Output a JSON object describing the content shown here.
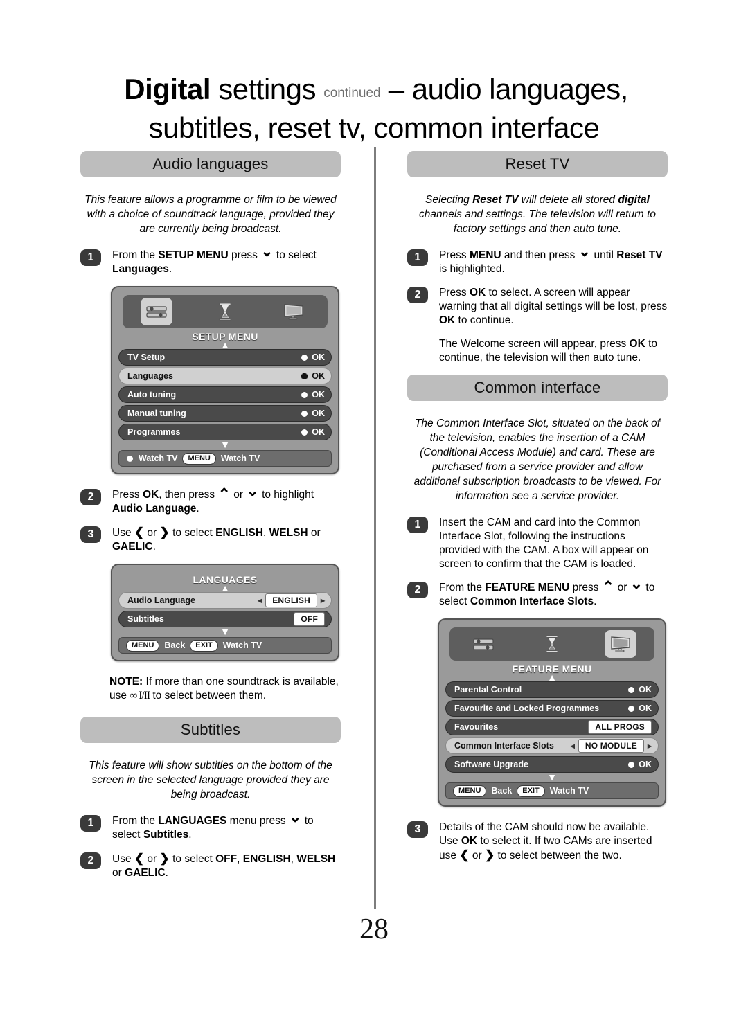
{
  "title": {
    "bold": "Digital",
    "regular": " settings ",
    "continued": "continued",
    "rest": " – audio languages,",
    "line2": "subtitles, reset tv, common interface"
  },
  "page_number": "28",
  "left_column": {
    "audio_languages": {
      "heading": "Audio languages",
      "intro": "This feature allows a programme or film to be viewed with a choice of soundtrack language, provided they are currently being broadcast.",
      "steps": [
        {
          "num": "1",
          "text_html": "From the <b>SETUP MENU</b> press <span class=\"ar ar-dn\"></span> to select <b>Languages</b>."
        },
        {
          "num": "2",
          "text_html": "Press <b>OK</b>, then press <span class=\"ar ar-up\"></span> or <span class=\"ar ar-dn\"></span> to highlight <b>Audio Language</b>."
        },
        {
          "num": "3",
          "text_html": "Use <span class=\"ar ar-lt\"></span> or <span class=\"ar ar-rt\"></span> to select <b>ENGLISH</b>, <b>WELSH</b> or <b>GAELIC</b>."
        }
      ],
      "note_html": "<b>NOTE:</b> If more than one soundtrack is available, use <span class=\"ii-glyph\">∞ I/II</span> to select between them."
    },
    "setup_menu_screen": {
      "title": "SETUP MENU",
      "icons": [
        "setup-sliders-icon",
        "hourglass-icon",
        "tv-screen-icon"
      ],
      "selected_icon_index": 0,
      "rows": [
        {
          "label": "TV Setup",
          "value": "OK",
          "highlighted": false,
          "control": "ok"
        },
        {
          "label": "Languages",
          "value": "OK",
          "highlighted": true,
          "control": "ok4"
        },
        {
          "label": "Auto tuning",
          "value": "OK",
          "highlighted": false,
          "control": "ok"
        },
        {
          "label": "Manual tuning",
          "value": "OK",
          "highlighted": false,
          "control": "ok"
        },
        {
          "label": "Programmes",
          "value": "OK",
          "highlighted": false,
          "control": "ok"
        }
      ],
      "footer": {
        "left_label": "Watch TV",
        "pill": "MENU",
        "right_label": "Watch TV"
      }
    },
    "languages_screen": {
      "title": "LANGUAGES",
      "rows": [
        {
          "label": "Audio Language",
          "value": "ENGLISH",
          "highlighted": true,
          "control": "lr"
        },
        {
          "label": "Subtitles",
          "value": "OFF",
          "highlighted": false,
          "control": "val"
        }
      ],
      "footer": {
        "pill1": "MENU",
        "label1": "Back",
        "pill2": "EXIT",
        "label2": "Watch TV"
      }
    },
    "subtitles": {
      "heading": "Subtitles",
      "intro": "This feature will show subtitles on the bottom of the screen in the selected language provided they are being broadcast.",
      "steps": [
        {
          "num": "1",
          "text_html": "From the <b>LANGUAGES</b> menu press <span class=\"ar ar-dn\"></span> to select <b>Subtitles</b>."
        },
        {
          "num": "2",
          "text_html": "Use <span class=\"ar ar-lt\"></span> or <span class=\"ar ar-rt\"></span> to select <b>OFF</b>, <b>ENGLISH</b>, <b>WELSH</b> or <b>GAELIC</b>."
        }
      ]
    }
  },
  "right_column": {
    "reset_tv": {
      "heading": "Reset TV",
      "intro_html": "Selecting <b>Reset TV</b> will delete all stored <b>digital</b> channels and settings. The television will return to factory settings and then auto tune.",
      "steps": [
        {
          "num": "1",
          "text_html": "Press <b>MENU</b> and then press <span class=\"ar ar-dn\"></span> until <b>Reset TV</b> is highlighted."
        },
        {
          "num": "2",
          "text_html": "Press <b>OK</b> to select. A screen will appear warning that all digital settings will be lost, press <b>OK</b> to continue."
        }
      ],
      "extra_para_html": "The Welcome screen will appear, press <b>OK</b> to continue, the television will then auto tune."
    },
    "common_interface": {
      "heading": "Common interface",
      "intro": "The Common Interface Slot, situated on the back of the television, enables the insertion of a CAM (Conditional Access Module) and card. These are purchased from a service provider and allow additional subscription broadcasts to be viewed. For information see a service provider.",
      "steps": [
        {
          "num": "1",
          "text_html": "Insert the CAM and card into the Common Interface Slot, following the instructions provided with the CAM. A box will appear on screen to confirm that the CAM is loaded."
        },
        {
          "num": "2",
          "text_html": "From the <b>FEATURE MENU</b> press <span class=\"ar ar-up\"></span> or <span class=\"ar ar-dn\"></span> to select <b>Common Interface Slots</b>."
        }
      ],
      "step3_html": "Details of the CAM should now be available. Use <b>OK</b> to select it. If two CAMs are inserted use <span class=\"ar ar-lt\"></span> or <span class=\"ar ar-rt\"></span> to select between the two.",
      "step3_num": "3"
    },
    "feature_menu_screen": {
      "title": "FEATURE MENU",
      "icons": [
        "setup-sliders-icon",
        "hourglass-icon",
        "tv-screen-icon"
      ],
      "selected_icon_index": 2,
      "rows": [
        {
          "label": "Parental Control",
          "value": "OK",
          "highlighted": false,
          "control": "ok"
        },
        {
          "label": "Favourite and Locked Programmes",
          "value": "OK",
          "highlighted": false,
          "control": "ok"
        },
        {
          "label": "Favourites",
          "value": "ALL PROGS",
          "highlighted": false,
          "control": "val"
        },
        {
          "label": "Common Interface Slots",
          "value": "NO MODULE",
          "highlighted": true,
          "control": "lr"
        },
        {
          "label": "Software Upgrade",
          "value": "OK",
          "highlighted": false,
          "control": "ok"
        }
      ],
      "footer": {
        "pill1": "MENU",
        "label1": "Back",
        "pill2": "EXIT",
        "label2": "Watch TV"
      }
    }
  },
  "colors": {
    "section_bar": "#bdbdbd",
    "step_badge": "#3a3a3a",
    "menu_bg": "#9a9a9a",
    "menu_row": "#4a4a4a",
    "menu_row_highlight": "#d0d0d0",
    "divider": "#7d7d7d"
  }
}
